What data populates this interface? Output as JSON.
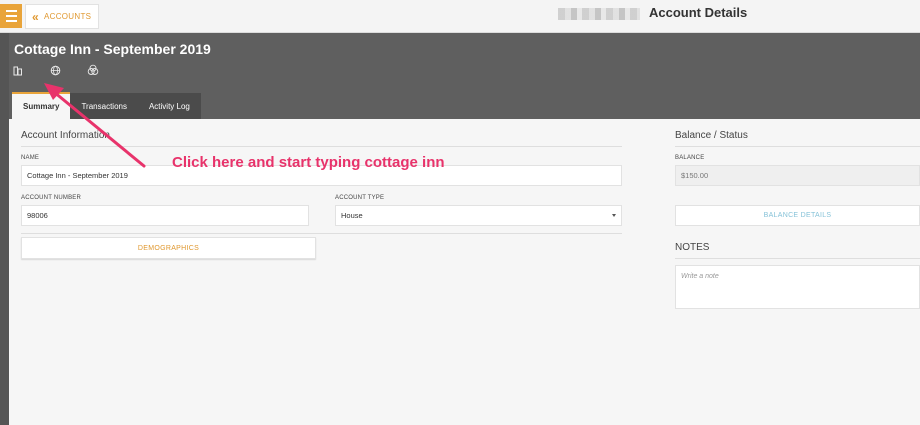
{
  "topbar": {
    "accounts_label": "ACCOUNTS",
    "title": "Account Details"
  },
  "header": {
    "account_name": "Cottage Inn - September 2019",
    "icons": [
      "building-icon",
      "globe-icon",
      "circles-icon"
    ]
  },
  "tabs": [
    {
      "label": "Summary",
      "active": true
    },
    {
      "label": "Transactions",
      "active": false
    },
    {
      "label": "Activity Log",
      "active": false
    }
  ],
  "account_info": {
    "title": "Account Information",
    "name_label": "NAME",
    "name_value": "Cottage Inn - September 2019",
    "number_label": "ACCOUNT NUMBER",
    "number_value": "98006",
    "type_label": "ACCOUNT TYPE",
    "type_value": "House",
    "demographics_button": "DEMOGRAPHICS"
  },
  "balance": {
    "title": "Balance / Status",
    "balance_label": "BALANCE",
    "balance_value": "$150.00",
    "details_button": "BALANCE DETAILS"
  },
  "notes": {
    "title": "NOTES",
    "placeholder": "Write a note"
  },
  "annotation": {
    "text": "Click here and start typing cottage inn",
    "color": "#e8336b"
  },
  "colors": {
    "accent": "#e9a43a",
    "header_bg": "#5f5f5f",
    "link_blue": "#86c2d8"
  }
}
